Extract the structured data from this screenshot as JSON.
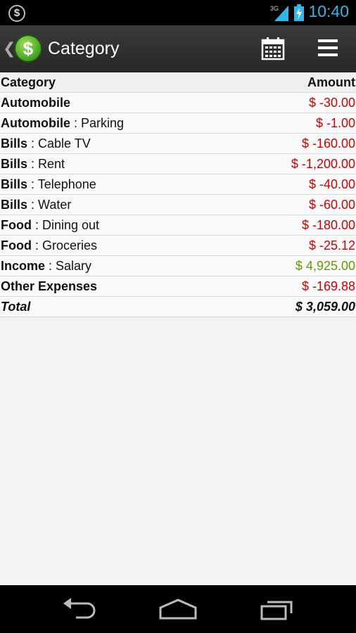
{
  "status_bar": {
    "notification_icon": "dollar-icon",
    "network_type": "3G",
    "time": "10:40"
  },
  "action_bar": {
    "title": "Category",
    "logo_symbol": "$",
    "actions": [
      "calendar-icon",
      "menu-icon"
    ]
  },
  "table": {
    "headers": {
      "category": "Category",
      "amount": "Amount"
    },
    "rows": [
      {
        "main": "Automobile",
        "sub": "",
        "amount": "$ -30.00",
        "type": "neg"
      },
      {
        "main": "Automobile",
        "sub": " : Parking",
        "amount": "$ -1.00",
        "type": "neg"
      },
      {
        "main": "Bills",
        "sub": " : Cable TV",
        "amount": "$ -160.00",
        "type": "neg"
      },
      {
        "main": "Bills",
        "sub": " : Rent",
        "amount": "$ -1,200.00",
        "type": "neg"
      },
      {
        "main": "Bills",
        "sub": " : Telephone",
        "amount": "$ -40.00",
        "type": "neg"
      },
      {
        "main": "Bills",
        "sub": " : Water",
        "amount": "$ -60.00",
        "type": "neg"
      },
      {
        "main": "Food",
        "sub": " : Dining out",
        "amount": "$ -180.00",
        "type": "neg"
      },
      {
        "main": "Food",
        "sub": " : Groceries",
        "amount": "$ -25.12",
        "type": "neg"
      },
      {
        "main": "Income",
        "sub": " : Salary",
        "amount": "$ 4,925.00",
        "type": "pos"
      },
      {
        "main": "Other Expenses",
        "sub": "",
        "amount": "$ -169.88",
        "type": "neg"
      }
    ],
    "total": {
      "label": "Total",
      "amount": "$ 3,059.00"
    }
  },
  "nav_bar": [
    "back-icon",
    "home-icon",
    "recent-apps-icon"
  ],
  "colors": {
    "negative": "#cc0000",
    "positive": "#669900",
    "status_accent": "#33b5e5"
  }
}
